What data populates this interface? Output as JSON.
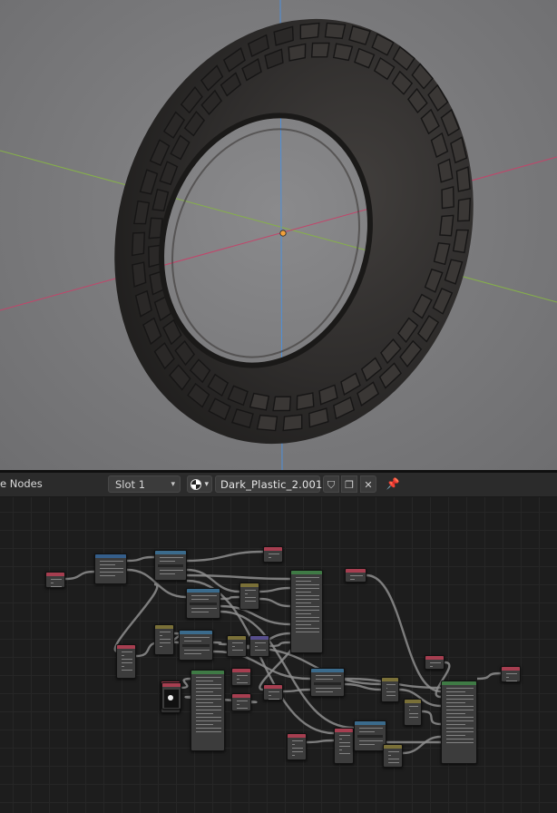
{
  "viewport": {
    "background": "#7f7f81",
    "tire_color": "#2e2c2b",
    "axis_x_color": "#c2456a",
    "axis_y_color": "#86b04a",
    "axis_z_color": "#4f8fd8",
    "origin_color": "#f2a13b"
  },
  "header": {
    "editor_label": "e Nodes",
    "slot": "Slot 1",
    "material_name": "Dark_Plastic_2.001",
    "icons": {
      "chevron": "▾",
      "shield": "⛉",
      "copy": "❐",
      "close": "✕",
      "pin": "📌"
    }
  },
  "node_editor": {
    "header_colors": {
      "input": "#a63e50",
      "texture": "#3b6b8c",
      "vector": "#574e8c",
      "converter": "#355e8a",
      "shader": "#3f7a45",
      "color": "#7a7038"
    }
  }
}
